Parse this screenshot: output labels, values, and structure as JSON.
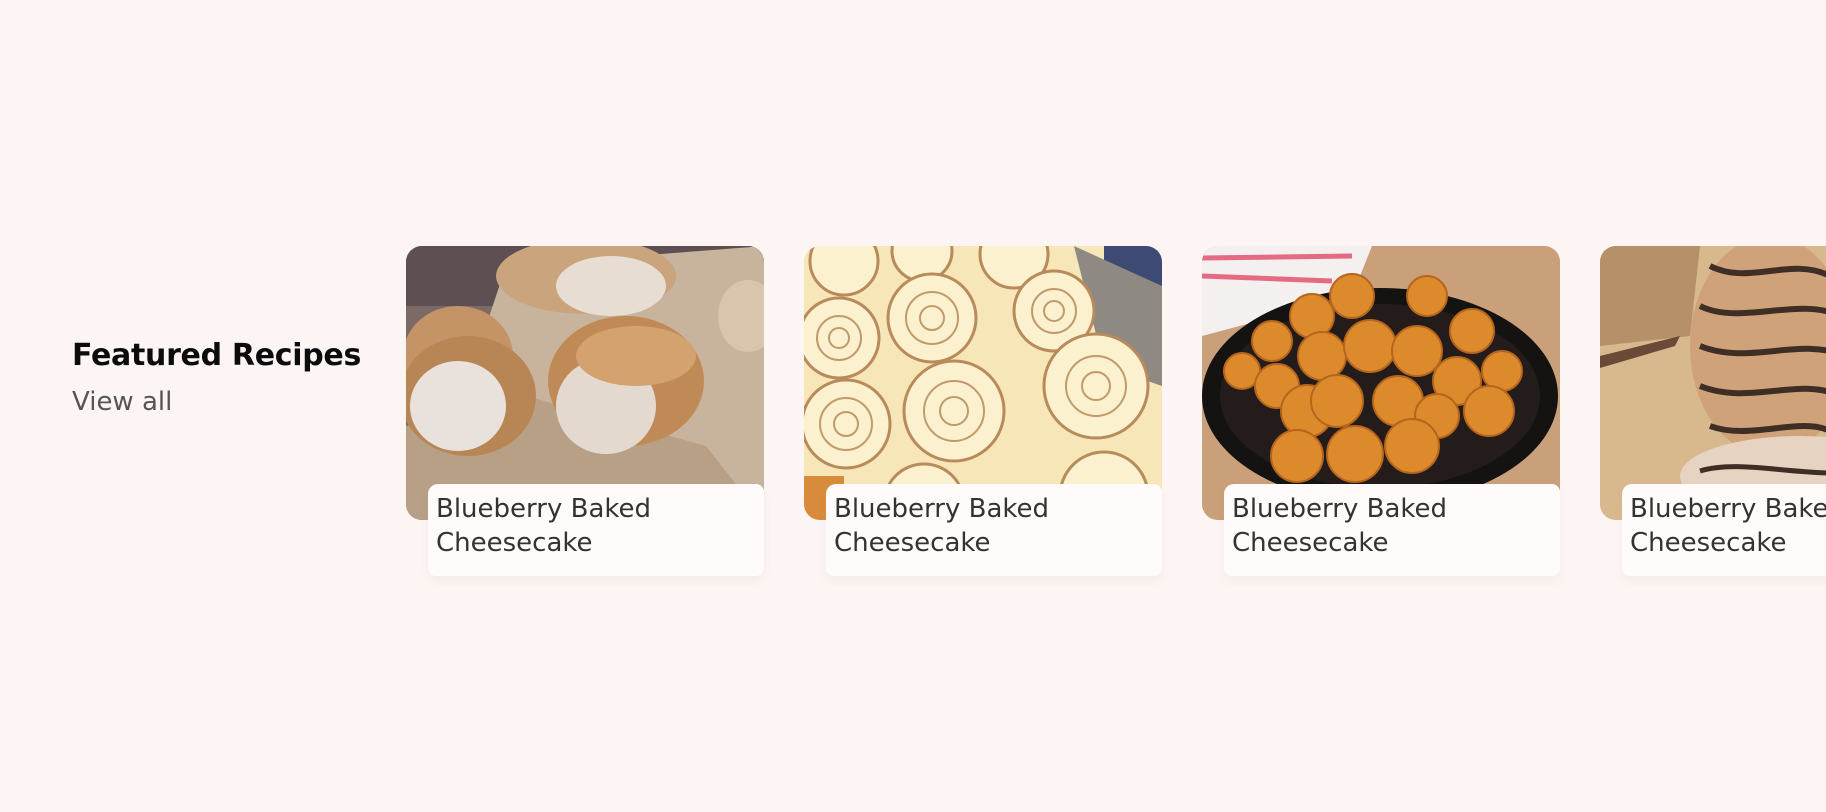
{
  "section": {
    "title": "Featured Recipes",
    "view_all": "View all"
  },
  "cards": [
    {
      "title_line1": "Blueberry Baked",
      "title_line2": "Cheesecake",
      "image": "bread-rolls"
    },
    {
      "title_line1": "Blueberry Baked",
      "title_line2": "Cheesecake",
      "image": "cinnamon-rolls"
    },
    {
      "title_line1": "Blueberry Baked",
      "title_line2": "Cheesecake",
      "image": "honey-balls"
    },
    {
      "title_line1": "Blueberry Baked",
      "title_line2": "Cheesecake",
      "image": "chocolate-babka"
    }
  ],
  "colors": {
    "background": "#fdf5f3",
    "caption_background": "#fefbfa",
    "title": "#0c0c0c",
    "link": "#555555"
  }
}
